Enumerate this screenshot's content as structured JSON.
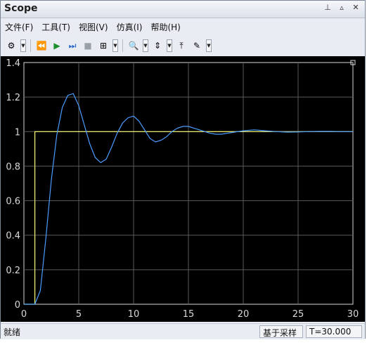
{
  "window": {
    "title": "Scope"
  },
  "menu": {
    "items": [
      {
        "label": "文件(F)"
      },
      {
        "label": "工具(T)"
      },
      {
        "label": "视图(V)"
      },
      {
        "label": "仿真(I)"
      },
      {
        "label": "帮助(H)"
      }
    ]
  },
  "toolbar": {
    "icons": [
      "gear-icon",
      "back-icon",
      "run-icon",
      "step-forward-icon",
      "stop-icon",
      "signal-icon",
      "zoom-in-icon",
      "axis-scale-icon",
      "highlight-icon",
      "style-icon"
    ]
  },
  "chart_data": {
    "type": "line",
    "xlim": [
      0,
      30
    ],
    "ylim": [
      0,
      1.4
    ],
    "xticks": [
      0,
      5,
      10,
      15,
      20,
      25,
      30
    ],
    "yticks": [
      0,
      0.2,
      0.4,
      0.6,
      0.8,
      1,
      1.2,
      1.4
    ],
    "ytick_labels": [
      "0",
      "0.2",
      "0.4",
      "0.6",
      "0.8",
      "1",
      "1.2",
      "1.4"
    ],
    "grid": true,
    "series": [
      {
        "color": "#ffff73",
        "x": [
          0,
          1,
          1,
          30
        ],
        "y": [
          0,
          0,
          1,
          1
        ]
      },
      {
        "color": "#4a9cff",
        "x": [
          0,
          1,
          1.5,
          2,
          2.5,
          3,
          3.5,
          4,
          4.5,
          5,
          5.5,
          6,
          6.5,
          7,
          7.5,
          8,
          8.5,
          9,
          9.5,
          10,
          10.5,
          11,
          11.5,
          12,
          12.5,
          13,
          13.5,
          14,
          14.5,
          15,
          15.5,
          16,
          16.5,
          17,
          17.5,
          18,
          18.5,
          19,
          20,
          21,
          22,
          23,
          24,
          25,
          26,
          27,
          28,
          29,
          30
        ],
        "y": [
          0,
          0,
          0.08,
          0.38,
          0.72,
          0.98,
          1.14,
          1.21,
          1.22,
          1.15,
          1.04,
          0.93,
          0.85,
          0.82,
          0.84,
          0.91,
          0.99,
          1.05,
          1.08,
          1.09,
          1.06,
          1.01,
          0.96,
          0.94,
          0.95,
          0.97,
          1.0,
          1.02,
          1.03,
          1.03,
          1.02,
          1.01,
          1.0,
          0.99,
          0.985,
          0.985,
          0.99,
          0.995,
          1.005,
          1.01,
          1.005,
          1.0,
          0.997,
          0.998,
          1.0,
          1.001,
          1.001,
          1.0,
          1.0
        ]
      }
    ]
  },
  "status": {
    "left_text": "就绪",
    "mode": "基于采样",
    "time": "T=30.000"
  }
}
